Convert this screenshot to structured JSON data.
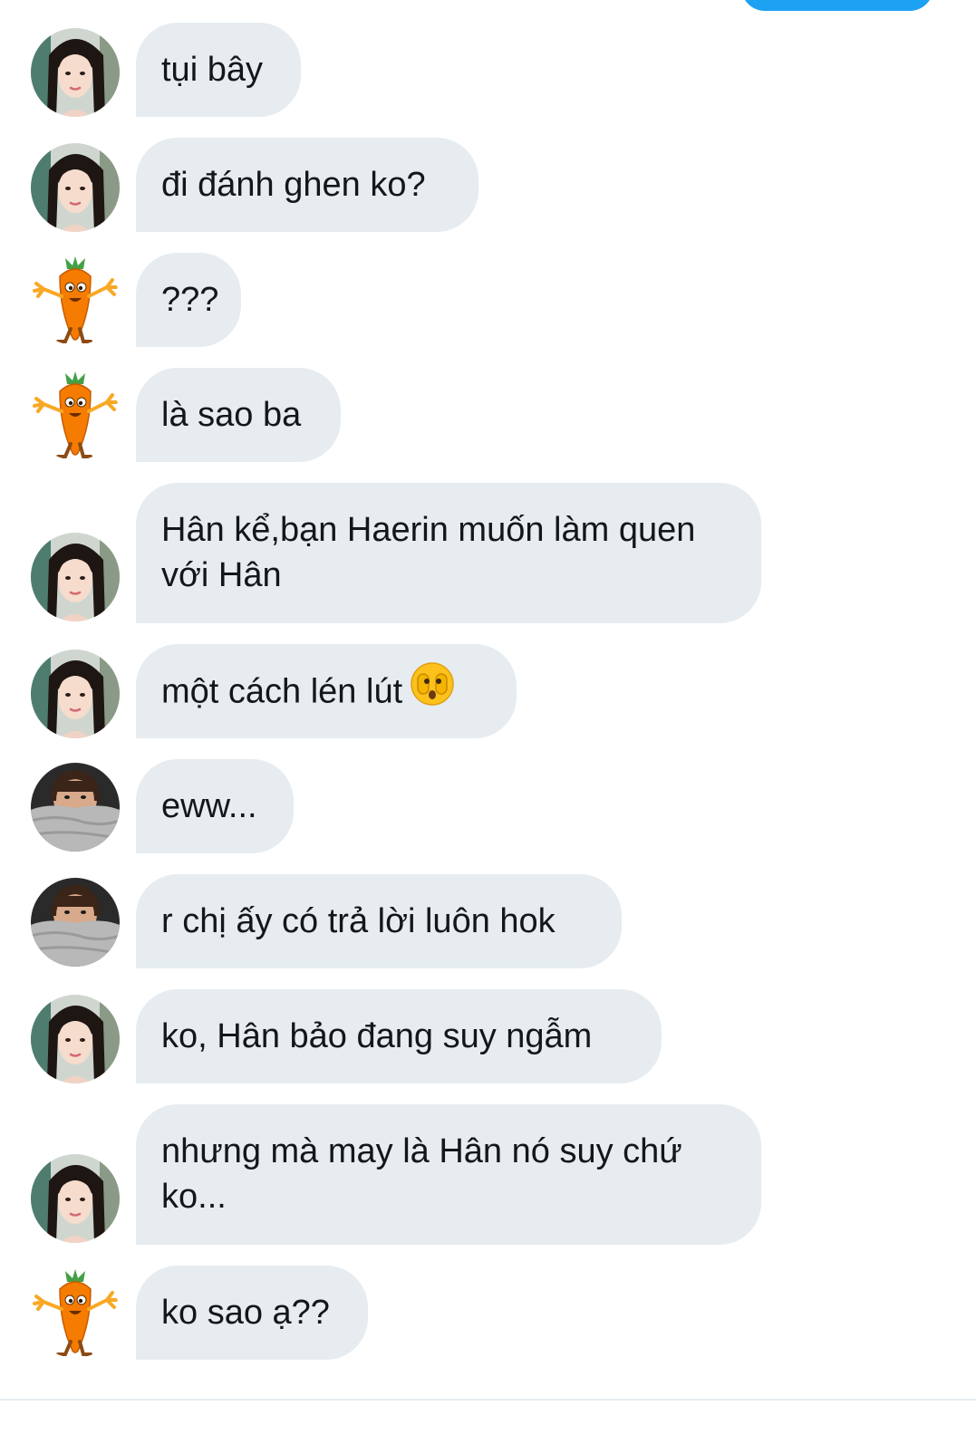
{
  "messages": [
    {
      "sender": "girl",
      "text": "tụi bây"
    },
    {
      "sender": "girl",
      "text": "đi đánh ghen ko?"
    },
    {
      "sender": "carrot",
      "text": "???"
    },
    {
      "sender": "carrot",
      "text": "là sao ba"
    },
    {
      "sender": "girl",
      "text": "Hân kể,bạn Haerin muốn làm quen với Hân"
    },
    {
      "sender": "girl",
      "text": "một cách lén lút",
      "emoji": "face-peeking-through-hands-icon"
    },
    {
      "sender": "blanket",
      "text": "eww..."
    },
    {
      "sender": "blanket",
      "text": "r chị ấy có trả lời luôn hok"
    },
    {
      "sender": "girl",
      "text": "ko, Hân bảo đang suy ngẫm"
    },
    {
      "sender": "girl",
      "text": "nhưng mà may là Hân nó suy chứ ko..."
    },
    {
      "sender": "carrot",
      "text": "ko sao ạ??"
    }
  ],
  "colors": {
    "bubble_bg": "#e6ecf0",
    "bubble_text": "#14171a",
    "sent_bubble": "#1da1f2"
  }
}
